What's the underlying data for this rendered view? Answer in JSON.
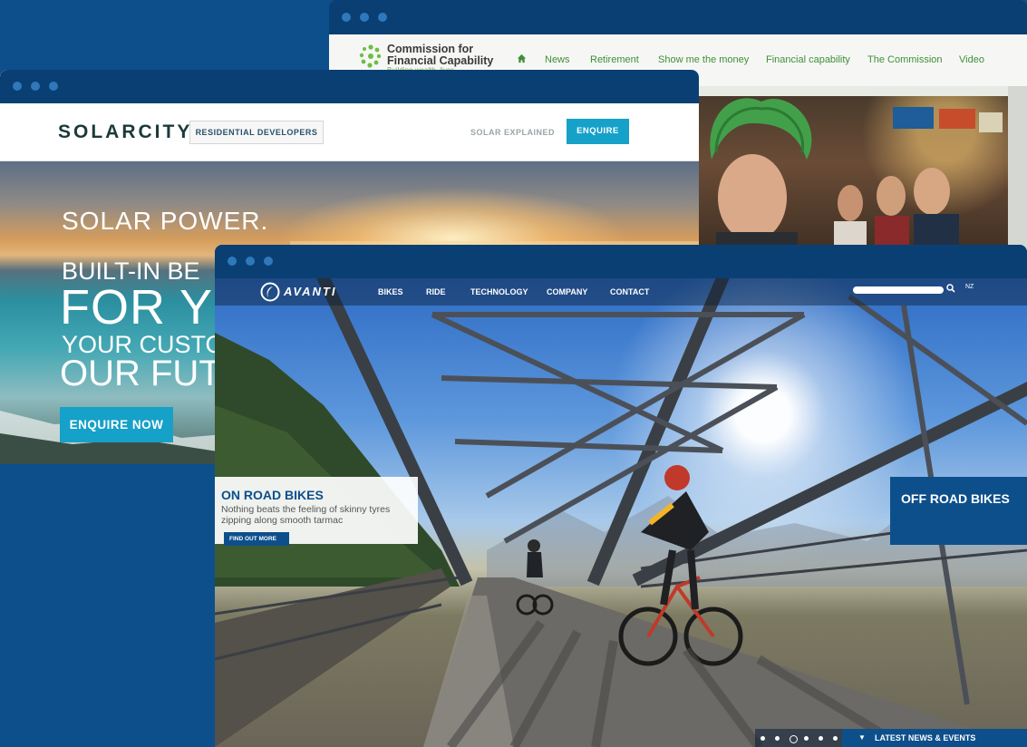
{
  "commission_window": {
    "logo_line1": "Commission for",
    "logo_line2": "Financial Capability",
    "tagline": "Building wealth, lives",
    "nav": [
      "News",
      "Retirement",
      "Show me the money",
      "Financial capability",
      "The Commission",
      "Video"
    ],
    "home_icon": "home-icon"
  },
  "solarcity_window": {
    "logo": "SOLARCITY",
    "residential_developers": "RESIDENTIAL DEVELOPERS",
    "solar_explained": "SOLAR EXPLAINED",
    "enquire": "ENQUIRE",
    "headline_1": "SOLAR POWER.",
    "headline_2": "BUILT-IN BE",
    "headline_3": "FOR Y",
    "headline_4": "YOUR CUSTO",
    "headline_5": "OUR FUT",
    "cta": "ENQUIRE NOW"
  },
  "avanti_window": {
    "logo": "AVANTI",
    "nav": [
      "BIKES",
      "RIDE",
      "TECHNOLOGY",
      "COMPANY",
      "CONTACT"
    ],
    "search_placeholder": "",
    "search_icon": "search-icon",
    "language": "NZ",
    "on_road_title": "ON ROAD BIKES",
    "on_road_desc": "Nothing beats the feeling of skinny tyres zipping along smooth tarmac",
    "find_out_more": "FIND OUT MORE",
    "off_road_title": "OFF ROAD BIKES",
    "slides_total": 6,
    "slide_active": 3,
    "latest_news": "LATEST NEWS & EVENTS"
  }
}
